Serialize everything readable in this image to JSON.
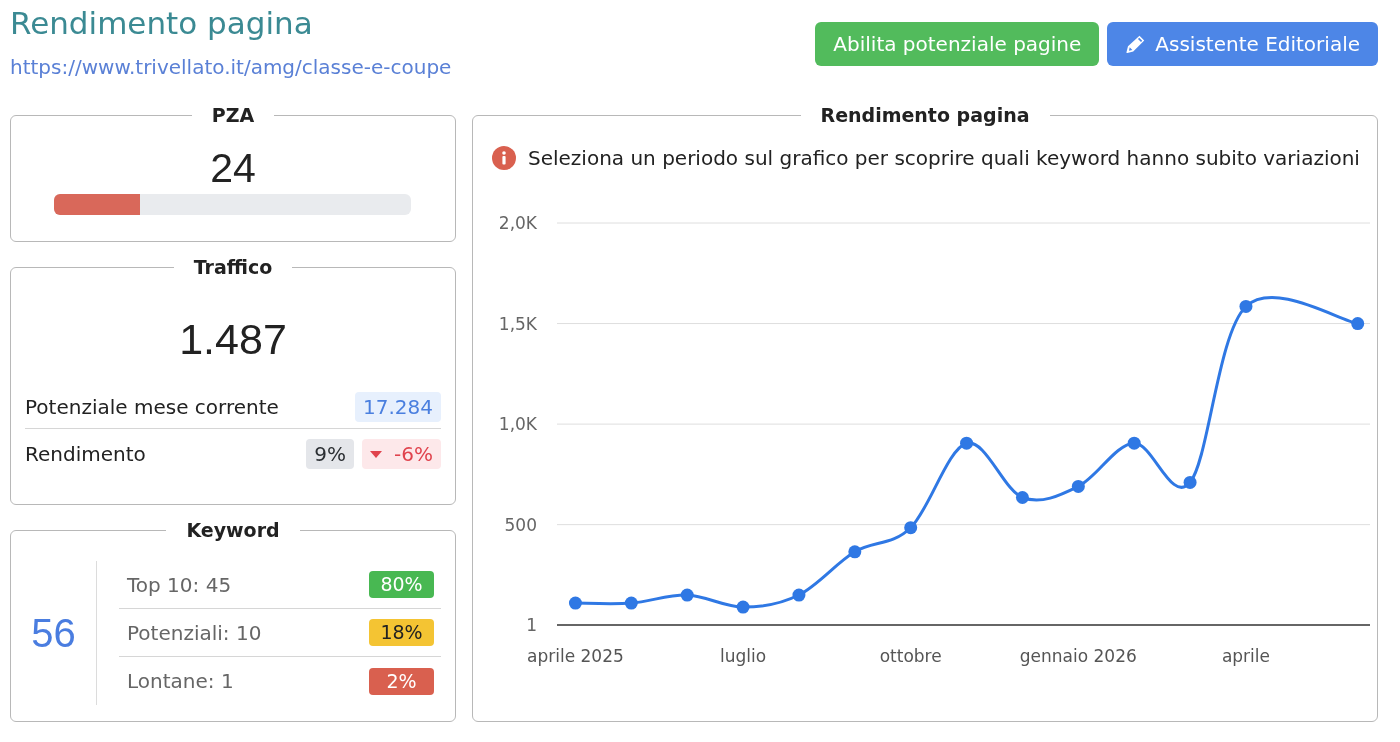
{
  "header": {
    "title": "Rendimento pagina",
    "url": "https://www.trivellato.it/amg/classe-e-coupe"
  },
  "actions": [
    {
      "label": "Abilita potenziale pagine",
      "kind": "success"
    },
    {
      "label": "Assistente Editoriale",
      "kind": "primary"
    }
  ],
  "pza": {
    "title": "PZA",
    "value": "24",
    "level": 0.24
  },
  "traffic": {
    "title": "Traffico",
    "value": "1.487",
    "rows": [
      {
        "label": "Potenziale mese corrente",
        "badges": [
          {
            "text": "17.284",
            "kind": "potential"
          }
        ]
      },
      {
        "label": "Rendimento",
        "badges": [
          {
            "text": "9%",
            "kind": "neutral"
          },
          {
            "text": "-6%",
            "kind": "down"
          }
        ]
      }
    ]
  },
  "keywords": {
    "title": "Keyword",
    "total": "56",
    "rows": [
      {
        "label": "Top 10: 45",
        "share": "80%",
        "color": "#48b852"
      },
      {
        "label": "Potenziali: 10",
        "share": "18%",
        "color": "#f4c433"
      },
      {
        "label": "Lontane: 1",
        "share": "2%",
        "color": "#d9604f"
      }
    ]
  },
  "performance": {
    "title": "Rendimento pagina",
    "notice": "Seleziona un periodo sul grafico per scoprire quali keyword hanno subito variazioni",
    "chart_data": {
      "type": "line",
      "grid": true,
      "categories": [
        "aprile 2025",
        null,
        null,
        "luglio",
        null,
        null,
        "ottobre",
        null,
        null,
        "gennaio 2026",
        null,
        null,
        "aprile",
        null,
        null
      ],
      "series": [
        {
          "color": "#2f78e4",
          "marker": "circle",
          "values": [
            110,
            110,
            150,
            90,
            150,
            365,
            485,
            905,
            635,
            690,
            905,
            710,
            1585,
            null,
            1500
          ]
        }
      ],
      "ylim": [
        1,
        2000
      ],
      "yticks": [
        {
          "value": 1,
          "label": "1"
        },
        {
          "value": 500,
          "label": "500"
        },
        {
          "value": 1000,
          "label": "1,0K"
        },
        {
          "value": 1500,
          "label": "1,5K"
        },
        {
          "value": 2000,
          "label": "2,0K"
        }
      ]
    }
  }
}
